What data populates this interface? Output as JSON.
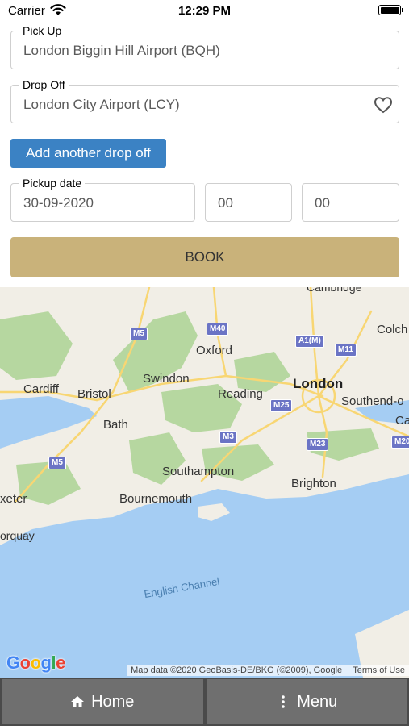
{
  "status_bar": {
    "carrier": "Carrier",
    "time": "12:29 PM",
    "wifi_icon": "wifi-icon",
    "battery_icon": "battery-icon"
  },
  "form": {
    "pickup": {
      "label": "Pick Up",
      "value": "London Biggin Hill Airport (BQH)"
    },
    "dropoff": {
      "label": "Drop Off",
      "value": "London City Airport (LCY)",
      "icon": "heart-icon"
    },
    "add_dropoff_label": "Add another drop off",
    "pickup_date": {
      "label": "Pickup date",
      "value": "30-09-2020"
    },
    "hour": {
      "value": "00"
    },
    "minute": {
      "value": "00"
    },
    "book_label": "BOOK"
  },
  "map": {
    "places": {
      "cambridge": "Cambridge",
      "colchester": "Colch",
      "oxford": "Oxford",
      "london": "London",
      "swindon": "Swindon",
      "cardiff": "Cardiff",
      "bristol": "Bristol",
      "reading": "Reading",
      "southend": "Southend-o",
      "bath": "Bath",
      "canterbury": "Ca",
      "southampton": "Southampton",
      "brighton": "Brighton",
      "bournemouth": "Bournemouth",
      "exeter": "xeter",
      "torquay": "orquay",
      "english_channel": "English Channel"
    },
    "roads": [
      "M5",
      "M40",
      "A1(M)",
      "M11",
      "M25",
      "M3",
      "M23",
      "M20",
      "M5"
    ],
    "google_logo": "Google",
    "attribution": "Map data ©2020 GeoBasis-DE/BKG (©2009), Google",
    "terms": "Terms of Use",
    "colors": {
      "land": "#f1eee6",
      "park": "#b6d7a0",
      "water": "#a5cdf3",
      "road": "#f8d673"
    }
  },
  "tab_bar": {
    "home": {
      "label": "Home",
      "icon": "home-icon"
    },
    "menu": {
      "label": "Menu",
      "icon": "more-vertical-icon"
    }
  }
}
